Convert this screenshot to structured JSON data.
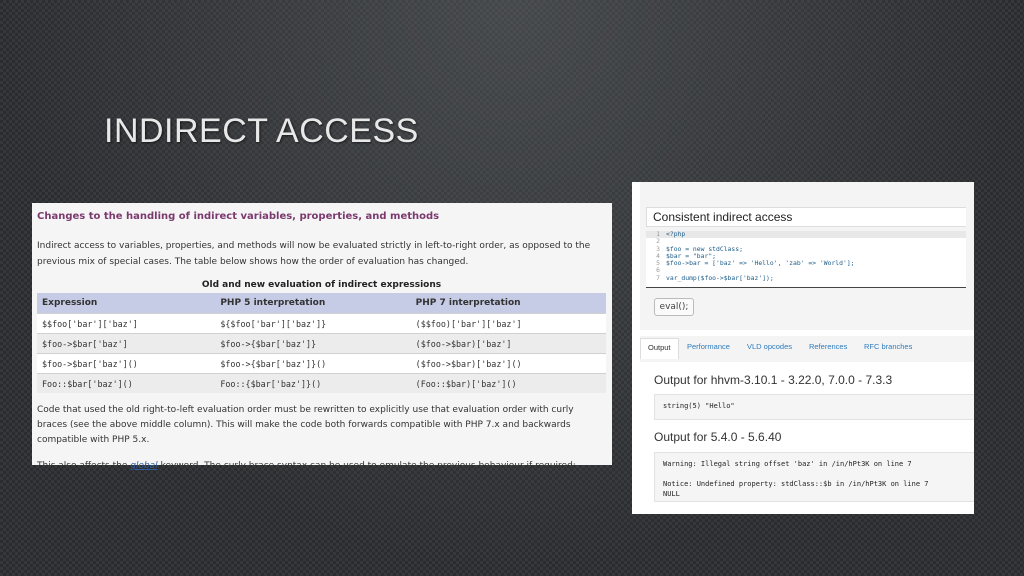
{
  "slide": {
    "title": "INDIRECT ACCESS"
  },
  "doc": {
    "heading": "Changes to the handling of indirect variables, properties, and methods",
    "intro": "Indirect access to variables, properties, and methods will now be evaluated strictly in left-to-right order, as opposed to the previous mix of special cases. The table below shows how the order of evaluation has changed.",
    "table_caption": "Old and new evaluation of indirect expressions",
    "columns": [
      "Expression",
      "PHP 5 interpretation",
      "PHP 7 interpretation"
    ],
    "rows": [
      [
        "$$foo['bar']['baz']",
        "${$foo['bar']['baz']}",
        "($$foo)['bar']['baz']"
      ],
      [
        "$foo->$bar['baz']",
        "$foo->{$bar['baz']}",
        "($foo->$bar)['baz']"
      ],
      [
        "$foo->$bar['baz']()",
        "$foo->{$bar['baz']}()",
        "($foo->$bar)['baz']()"
      ],
      [
        "Foo::$bar['baz']()",
        "Foo::{$bar['baz']}()",
        "(Foo::$bar)['baz']()"
      ]
    ],
    "after_text": "Code that used the old right-to-left evaluation order must be rewritten to explicitly use that evaluation order with curly braces (see the above middle column). This will make the code both forwards compatible with PHP 7.x and backwards compatible with PHP 5.x.",
    "also_prefix": "This also affects the ",
    "also_link": "global",
    "also_suffix": " keyword. The curly brace syntax can be used to emulate the previous behaviour if required:"
  },
  "sandbox": {
    "title": "Consistent indirect access",
    "code_lines": [
      {
        "n": "1",
        "text": "<?php"
      },
      {
        "n": "2",
        "text": ""
      },
      {
        "n": "3",
        "text": "$foo = new stdClass;"
      },
      {
        "n": "4",
        "text": "$bar = \"bar\";"
      },
      {
        "n": "5",
        "text": "$foo->bar = ['baz' => 'Hello', 'zab' => 'World'];"
      },
      {
        "n": "6",
        "text": ""
      },
      {
        "n": "7",
        "text": "var_dump($foo->$bar['baz']);"
      }
    ],
    "eval_label": "eval();",
    "tabs": [
      "Output",
      "Performance",
      "VLD opcodes",
      "References",
      "RFC branches"
    ],
    "outputs": [
      {
        "heading": "Output for hhvm-3.10.1 - 3.22.0, 7.0.0 - 7.3.3",
        "text": "string(5) \"Hello\""
      },
      {
        "heading": "Output for 5.4.0 - 5.6.40",
        "text": "Warning: Illegal string offset 'baz' in /in/hPt3K on line 7\n\nNotice: Undefined property: stdClass::$b in /in/hPt3K on line 7\nNULL"
      }
    ]
  }
}
